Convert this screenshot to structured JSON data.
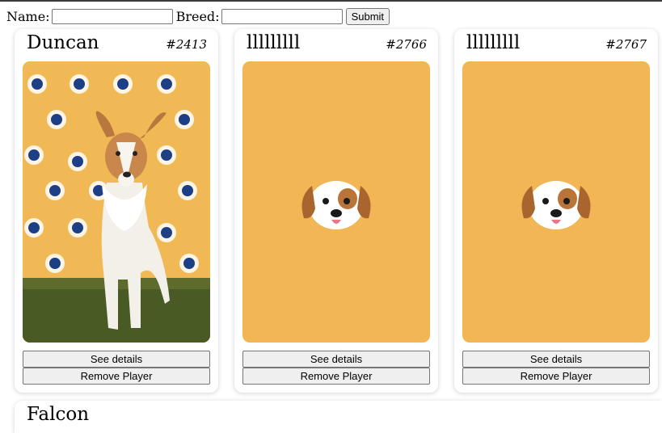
{
  "form": {
    "name_label": "Name:",
    "name_value": "",
    "breed_label": "Breed:",
    "breed_value": "",
    "submit_label": "Submit"
  },
  "cards": [
    {
      "name": "Duncan",
      "id": "#2413",
      "image": "dog-photo",
      "details_label": "See details",
      "remove_label": "Remove Player"
    },
    {
      "name": "lllllllll",
      "id": "#2766",
      "image": "dog-emoji-icon",
      "details_label": "See details",
      "remove_label": "Remove Player"
    },
    {
      "name": "lllllllll",
      "id": "#2767",
      "image": "dog-emoji-icon",
      "details_label": "See details",
      "remove_label": "Remove Player"
    },
    {
      "name": "Falcon"
    }
  ],
  "colors": {
    "placeholder_bg": "#f2b655",
    "button_bg": "#efefef"
  }
}
